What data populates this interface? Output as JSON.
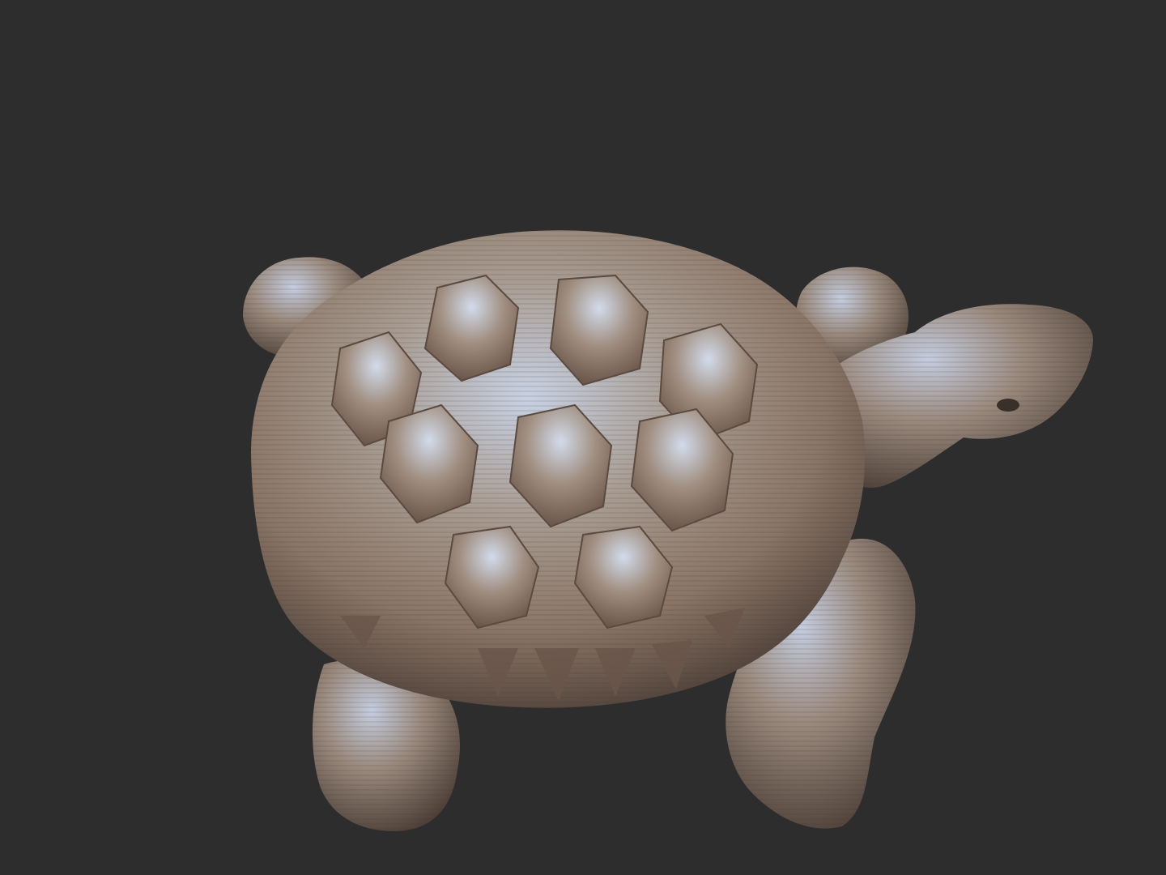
{
  "scene": {
    "subject": "tortoise-sculpt",
    "background_color": "#2d2d2d",
    "material_colors": {
      "highlight": "#c9d4e6",
      "midtone": "#9a8c80",
      "warm": "#b08a6c",
      "shadow": "#4a3d36"
    }
  }
}
